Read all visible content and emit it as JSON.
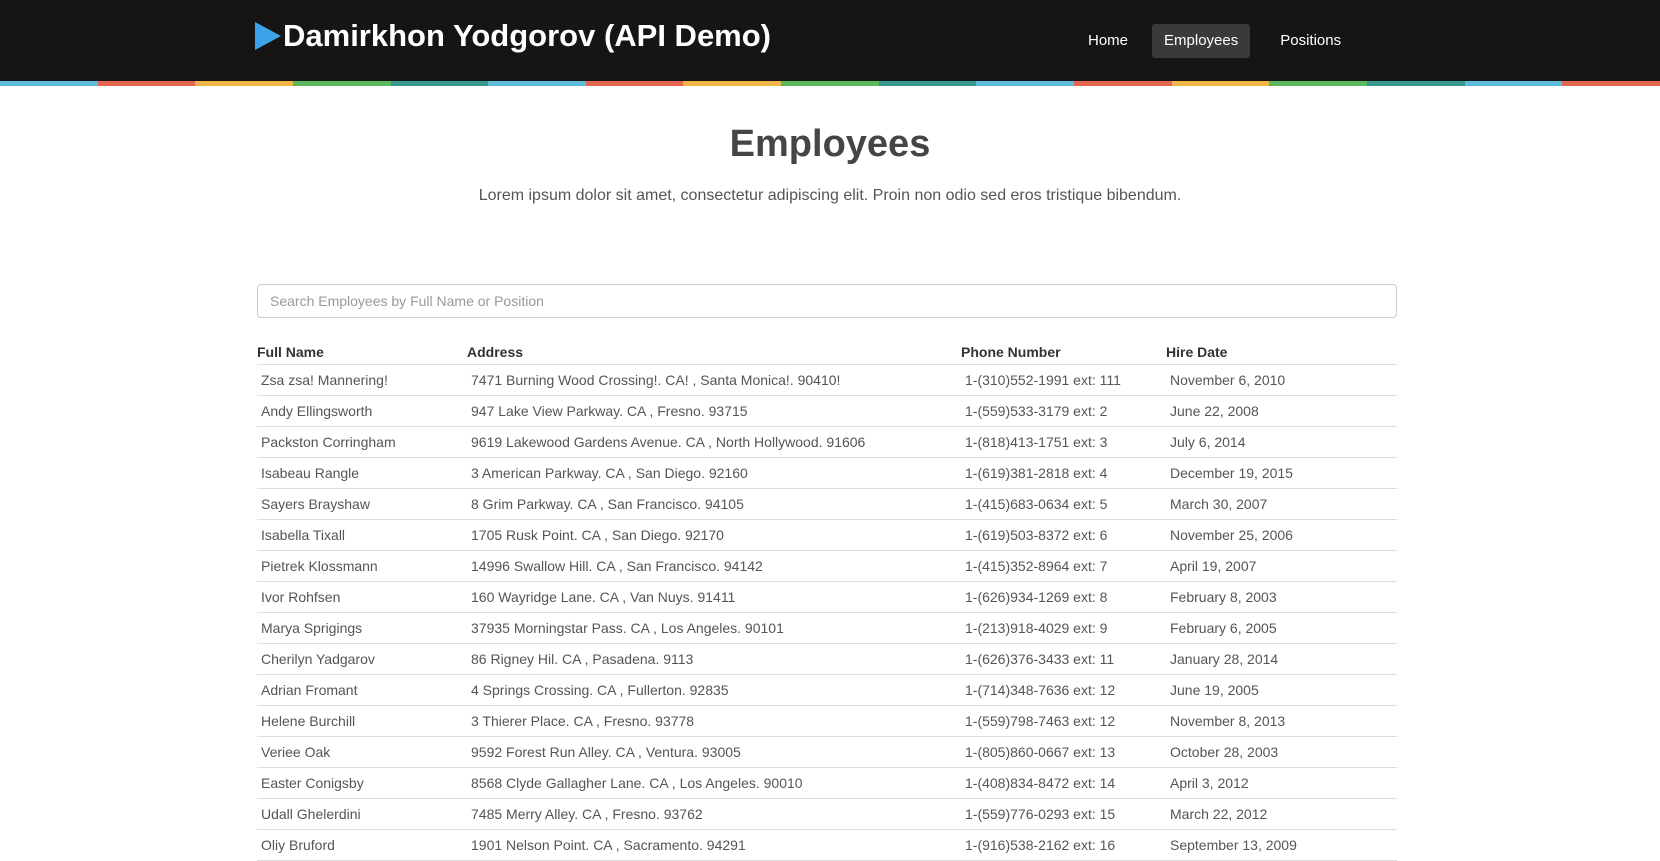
{
  "header": {
    "brand_title": "Damirkhon Yodgorov (API Demo)",
    "brand_icon": "play-triangle-icon",
    "nav": [
      {
        "label": "Home",
        "active": false
      },
      {
        "label": "Employees",
        "active": true
      },
      {
        "label": "Positions",
        "active": false
      }
    ],
    "stripe_colors": [
      "#5dbad9",
      "#e3654f",
      "#f2b646",
      "#5bb85c",
      "#36988d"
    ]
  },
  "page": {
    "title": "Employees",
    "subtitle": "Lorem ipsum dolor sit amet, consectetur adipiscing elit. Proin non odio sed eros tristique bibendum."
  },
  "search": {
    "placeholder": "Search Employees by Full Name or Position",
    "value": ""
  },
  "table": {
    "columns": [
      "Full Name",
      "Address",
      "Phone Number",
      "Hire Date"
    ],
    "rows": [
      [
        "Zsa zsa! Mannering!",
        "7471 Burning Wood Crossing!. CA! , Santa Monica!. 90410!",
        "1-(310)552-1991 ext: 111",
        "November 6, 2010"
      ],
      [
        "Andy Ellingsworth",
        "947 Lake View Parkway. CA , Fresno. 93715",
        "1-(559)533-3179 ext: 2",
        "June 22, 2008"
      ],
      [
        "Packston Corringham",
        "9619 Lakewood Gardens Avenue. CA , North Hollywood. 91606",
        "1-(818)413-1751 ext: 3",
        "July 6, 2014"
      ],
      [
        "Isabeau Rangle",
        "3 American Parkway. CA , San Diego. 92160",
        "1-(619)381-2818 ext: 4",
        "December 19, 2015"
      ],
      [
        "Sayers Brayshaw",
        "8 Grim Parkway. CA , San Francisco. 94105",
        "1-(415)683-0634 ext: 5",
        "March 30, 2007"
      ],
      [
        "Isabella Tixall",
        "1705 Rusk Point. CA , San Diego. 92170",
        "1-(619)503-8372 ext: 6",
        "November 25, 2006"
      ],
      [
        "Pietrek Klossmann",
        "14996 Swallow Hill. CA , San Francisco. 94142",
        "1-(415)352-8964 ext: 7",
        "April 19, 2007"
      ],
      [
        "Ivor Rohfsen",
        "160 Wayridge Lane. CA , Van Nuys. 91411",
        "1-(626)934-1269 ext: 8",
        "February 8, 2003"
      ],
      [
        "Marya Sprigings",
        "37935 Morningstar Pass. CA , Los Angeles. 90101",
        "1-(213)918-4029 ext: 9",
        "February 6, 2005"
      ],
      [
        "Cherilyn Yadgarov",
        "86 Rigney Hil. CA , Pasadena. 9113",
        "1-(626)376-3433 ext: 11",
        "January 28, 2014"
      ],
      [
        "Adrian Fromant",
        "4 Springs Crossing. CA , Fullerton. 92835",
        "1-(714)348-7636 ext: 12",
        "June 19, 2005"
      ],
      [
        "Helene Burchill",
        "3 Thierer Place. CA , Fresno. 93778",
        "1-(559)798-7463 ext: 12",
        "November 8, 2013"
      ],
      [
        "Veriee Oak",
        "9592 Forest Run Alley. CA , Ventura. 93005",
        "1-(805)860-0667 ext: 13",
        "October 28, 2003"
      ],
      [
        "Easter Conigsby",
        "8568 Clyde Gallagher Lane. CA , Los Angeles. 90010",
        "1-(408)834-8472 ext: 14",
        "April 3, 2012"
      ],
      [
        "Udall Ghelerdini",
        "7485 Merry Alley. CA , Fresno. 93762",
        "1-(559)776-0293 ext: 15",
        "March 22, 2012"
      ],
      [
        "Oliy Bruford",
        "1901 Nelson Point. CA , Sacramento. 94291",
        "1-(916)538-2162 ext: 16",
        "September 13, 2009"
      ]
    ]
  }
}
